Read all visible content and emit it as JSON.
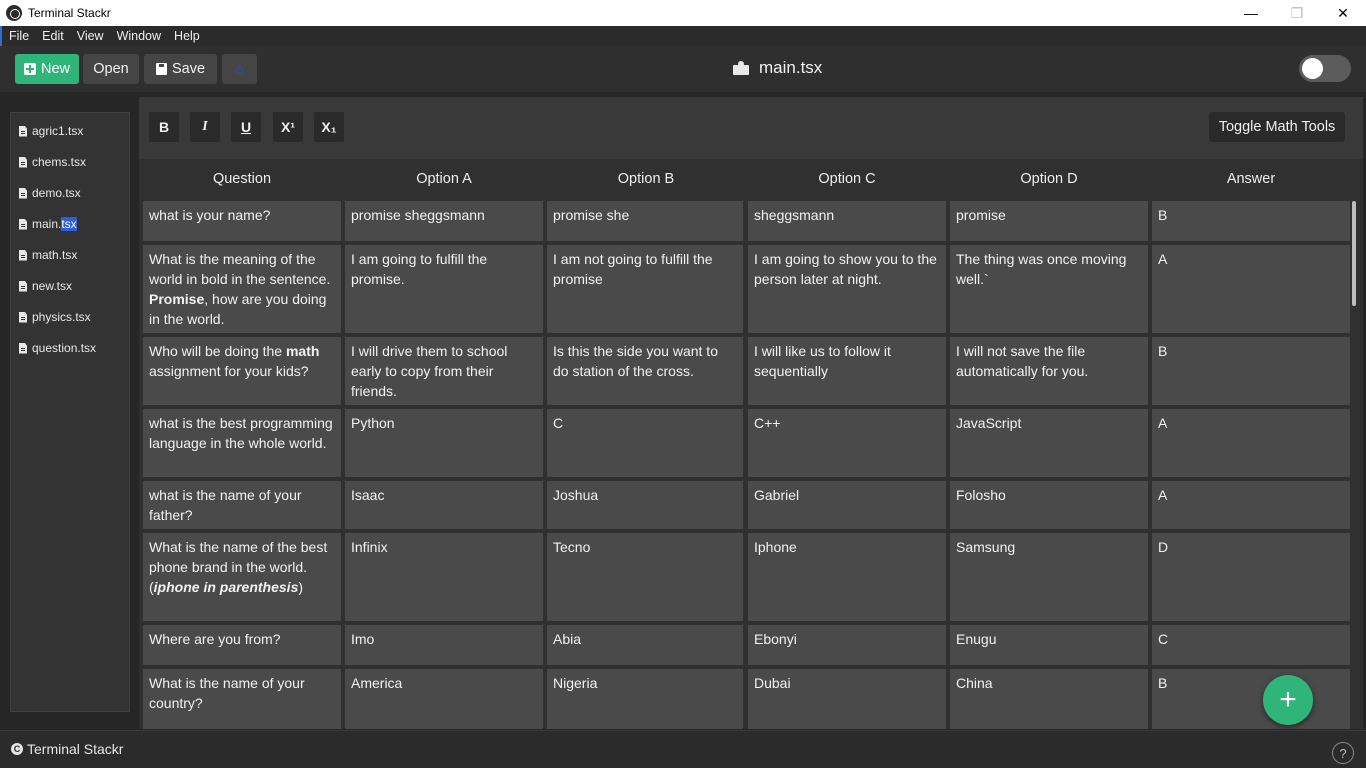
{
  "window": {
    "title": "Terminal Stackr",
    "controls": {
      "minimize": "—",
      "maximize": "❐",
      "close": "✕"
    }
  },
  "menu": [
    "File",
    "Edit",
    "View",
    "Window",
    "Help"
  ],
  "toolbar": {
    "new_label": "New",
    "open_label": "Open",
    "save_label": "Save",
    "home_icon": "home-icon",
    "file_title": "main.tsx",
    "dark_mode_toggle": "off"
  },
  "sidebar": {
    "files": [
      {
        "prefix": "agric1.tsx",
        "selected": ""
      },
      {
        "prefix": "chems.tsx",
        "selected": ""
      },
      {
        "prefix": "demo.tsx",
        "selected": ""
      },
      {
        "prefix": "main.",
        "selected": "tsx"
      },
      {
        "prefix": "math.tsx",
        "selected": ""
      },
      {
        "prefix": "new.tsx",
        "selected": ""
      },
      {
        "prefix": "physics.tsx",
        "selected": ""
      },
      {
        "prefix": "question.tsx",
        "selected": ""
      }
    ]
  },
  "format": {
    "bold": "B",
    "italic": "I",
    "underline": "U",
    "superscript": "X¹",
    "subscript": "X₁",
    "math_tools": "Toggle Math Tools"
  },
  "table": {
    "headers": [
      "Question",
      "Option A",
      "Option B",
      "Option C",
      "Option D",
      "Answer"
    ],
    "rows": [
      {
        "q": [
          {
            "t": "what is your name?"
          }
        ],
        "a": "promise sheggsmann",
        "b": "promise she",
        "c": "sheggsmann",
        "d": "promise",
        "ans": "B"
      },
      {
        "q": [
          {
            "t": "What is the meaning of the world in bold in the sentence. "
          },
          {
            "t": "Promise",
            "s": "b"
          },
          {
            "t": ", how are you doing in the world."
          }
        ],
        "a": "I am going to fulfill the promise.",
        "b": "I am not going to fulfill the promise",
        "c": "I am going to show you to the person later at night.",
        "d": "The thing was once moving well.`",
        "ans": "A"
      },
      {
        "q": [
          {
            "t": "Who will be doing the "
          },
          {
            "t": "math",
            "s": "b"
          },
          {
            "t": " assignment for your kids?"
          }
        ],
        "a": "I will drive them to school early to copy from their friends.",
        "b": "Is this the side you want to do station of the cross.",
        "c": "I will like us to follow it sequentially",
        "d": "I will not save the file automatically for you.",
        "ans": "B"
      },
      {
        "q": [
          {
            "t": "what is the best programming language in the whole world."
          }
        ],
        "a": "Python",
        "b": "C",
        "c": "C++",
        "d": "JavaScript",
        "ans": "A"
      },
      {
        "q": [
          {
            "t": "what is the name of your father?"
          }
        ],
        "a": "Isaac",
        "b": "Joshua",
        "c": "Gabriel",
        "d": "Folosho",
        "ans": "A"
      },
      {
        "q": [
          {
            "t": "What is the name of the best phone brand in the world. ("
          },
          {
            "t": "iphone in parenthesis",
            "s": "bi"
          },
          {
            "t": ")"
          }
        ],
        "a": "Infinix",
        "b": "Tecno",
        "c": "Iphone",
        "d": "Samsung",
        "ans": "D"
      },
      {
        "q": [
          {
            "t": "Where are you from?"
          }
        ],
        "a": "Imo",
        "b": "Abia",
        "c": "Ebonyi",
        "d": "Enugu",
        "ans": "C"
      },
      {
        "q": [
          {
            "t": "What is the name of your country?"
          }
        ],
        "a": "America",
        "b": "Nigeria",
        "c": "Dubai",
        "d": "China",
        "ans": "B"
      }
    ]
  },
  "fab": {
    "label": "+"
  },
  "status": {
    "brand": "Terminal Stackr",
    "help": "?"
  }
}
